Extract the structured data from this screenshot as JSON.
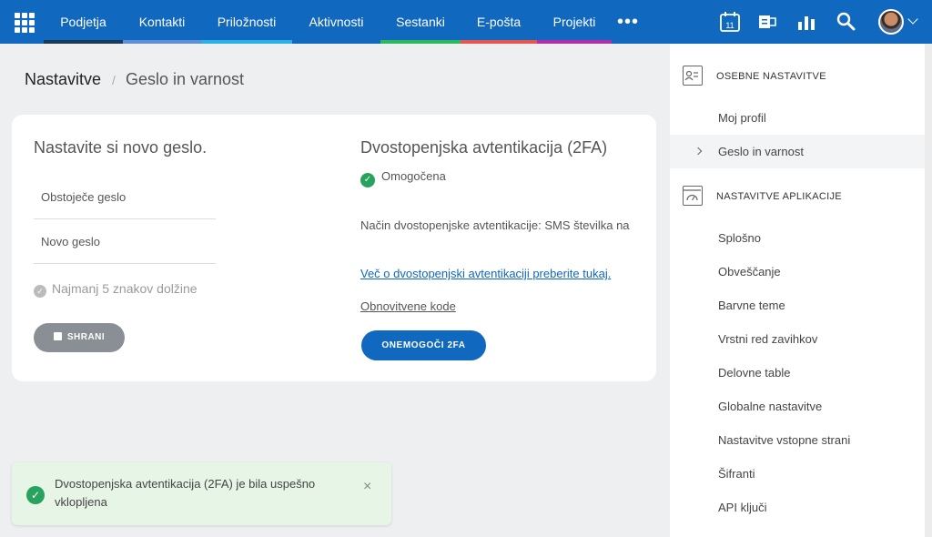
{
  "nav": {
    "items": [
      {
        "label": "Podjetja",
        "color": "#1a3a5c"
      },
      {
        "label": "Kontakti",
        "color": "#5c8fd6"
      },
      {
        "label": "Priložnosti",
        "color": "#2bb0e6"
      },
      {
        "label": "Aktivnosti",
        "color": "#1068bf"
      },
      {
        "label": "Sestanki",
        "color": "#2eb85c"
      },
      {
        "label": "E-pošta",
        "color": "#e8554e"
      },
      {
        "label": "Projekti",
        "color": "#b12fa8"
      }
    ],
    "more_label": "•••",
    "calendar_day": "11",
    "icons": [
      "apps-grid-icon",
      "calendar-icon",
      "exchange-icon",
      "stats-icon",
      "search-icon",
      "avatar",
      "chevron-down-icon"
    ]
  },
  "breadcrumb": {
    "root": "Nastavitve",
    "separator": "/",
    "current": "Geslo in varnost"
  },
  "password": {
    "title": "Nastavite si novo geslo.",
    "current_label": "Obstoječe geslo",
    "new_label": "Novo geslo",
    "rule": "Najmanj 5 znakov dolžine",
    "save_label": "SHRANI"
  },
  "twofa": {
    "title": "Dvostopenjska avtentikacija (2FA)",
    "status": "Omogočena",
    "method": "Način dvostopenjske avtentikacije: SMS številka na",
    "more_link": "Več o dvostopenjski avtentikaciji preberite tukaj.",
    "codes_link": "Obnovitvene kode",
    "disable_label": "ONEMOGOČI 2FA"
  },
  "toast": {
    "message": "Dvostopenjska avtentikacija (2FA) je bila uspešno vklopljena",
    "close": "×"
  },
  "sidebar": {
    "personal_title": "OSEBNE NASTAVITVE",
    "personal_items": [
      "Moj profil",
      "Geslo in varnost"
    ],
    "app_title": "NASTAVITVE APLIKACIJE",
    "app_items": [
      "Splošno",
      "Obveščanje",
      "Barvne teme",
      "Vrstni red zavihkov",
      "Delovne table",
      "Globalne nastavitve",
      "Nastavitve vstopne strani",
      "Šifranti",
      "API ključi"
    ]
  }
}
